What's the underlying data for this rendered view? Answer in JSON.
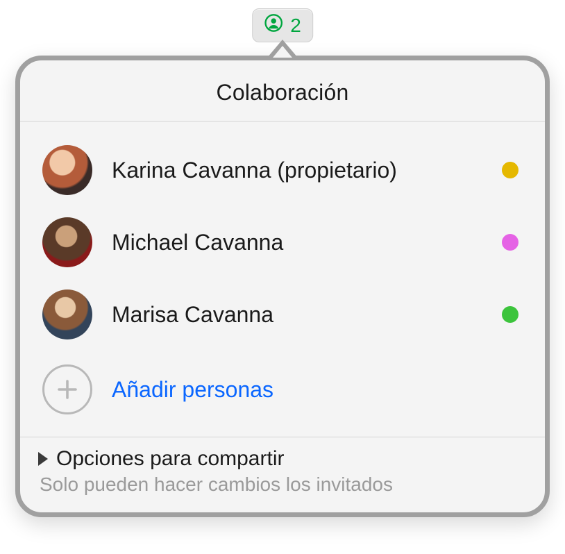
{
  "badge": {
    "count": "2"
  },
  "popover": {
    "title": "Colaboración",
    "participants": [
      {
        "name": "Karina Cavanna (propietario)",
        "color": "#e5b800"
      },
      {
        "name": "Michael Cavanna",
        "color": "#e562e5"
      },
      {
        "name": "Marisa Cavanna",
        "color": "#3cc43c"
      }
    ],
    "add_label": "Añadir personas",
    "footer": {
      "title": "Opciones para compartir",
      "subtitle": "Solo pueden hacer cambios los invitados"
    }
  }
}
